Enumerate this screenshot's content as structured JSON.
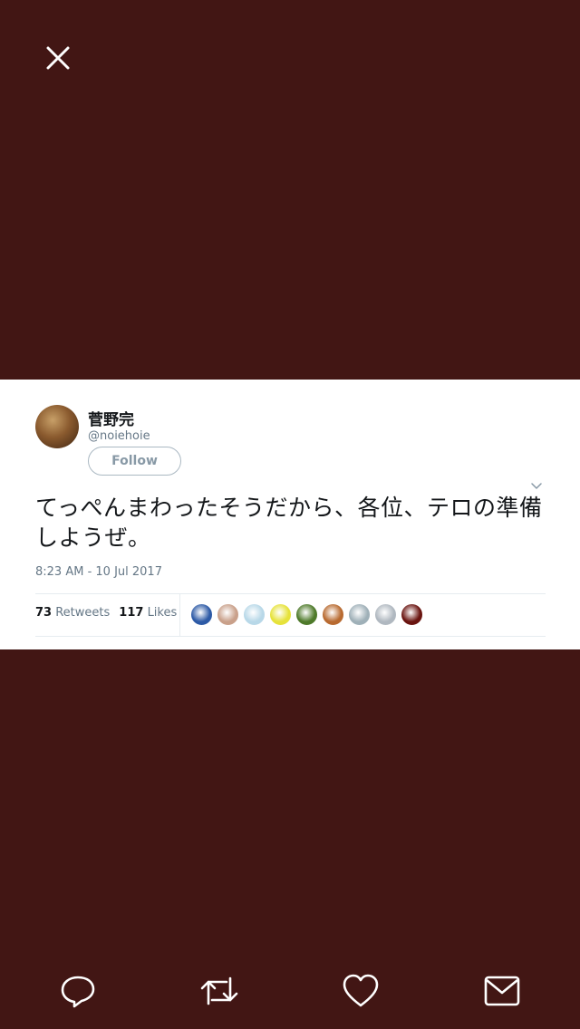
{
  "tweet": {
    "display_name": "菅野完",
    "screen_name": "@noiehoie",
    "follow_label": "Follow",
    "text": "てっぺんまわったそうだから、各位、テロの準備しようぜ。",
    "timestamp": "8:23 AM - 10 Jul 2017",
    "retweets_count": "73",
    "retweets_label": "Retweets",
    "likes_count": "117",
    "likes_label": "Likes"
  },
  "colors": {
    "background": "#421614",
    "card": "#ffffff",
    "text_primary": "#14171a",
    "text_secondary": "#657786"
  },
  "likers": [
    {
      "name": "liker-avatar-1",
      "color": "#2d5aa6"
    },
    {
      "name": "liker-avatar-2",
      "color": "#c9a08a"
    },
    {
      "name": "liker-avatar-3",
      "color": "#b8d8e8"
    },
    {
      "name": "liker-avatar-4",
      "color": "#e6e23a"
    },
    {
      "name": "liker-avatar-5",
      "color": "#4e7a2a"
    },
    {
      "name": "liker-avatar-6",
      "color": "#b86a30"
    },
    {
      "name": "liker-avatar-7",
      "color": "#9fb0b8"
    },
    {
      "name": "liker-avatar-8",
      "color": "#b0b8c0"
    },
    {
      "name": "liker-avatar-9",
      "color": "#6a1410"
    }
  ],
  "actions": [
    {
      "name": "reply-icon"
    },
    {
      "name": "retweet-icon"
    },
    {
      "name": "like-icon"
    },
    {
      "name": "direct-message-icon"
    }
  ]
}
